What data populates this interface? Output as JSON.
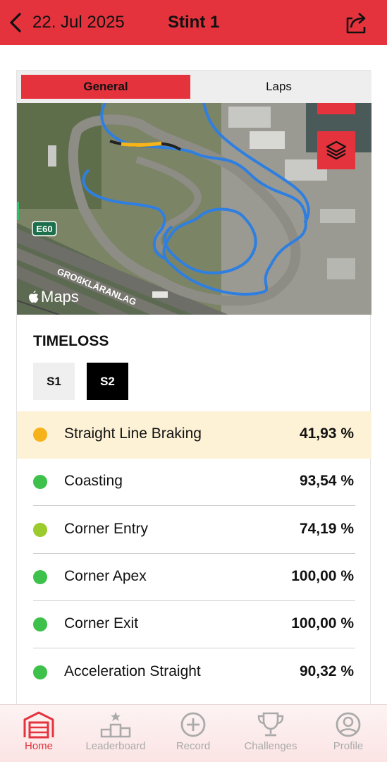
{
  "header": {
    "date": "22. Jul 2025",
    "title": "Stint 1"
  },
  "tabs": [
    {
      "label": "General",
      "active": true
    },
    {
      "label": "Laps",
      "active": false
    }
  ],
  "map": {
    "attribution": "Maps",
    "road_label": "E60",
    "street_label": "GROßKLÄRANLAG"
  },
  "timeloss": {
    "title": "TIMELOSS",
    "sectors": [
      {
        "label": "S1",
        "selected": false
      },
      {
        "label": "S2",
        "selected": true
      }
    ],
    "items": [
      {
        "label": "Straight Line Braking",
        "value": "41,93 %",
        "status_color": "#f5b21b",
        "highlighted": true
      },
      {
        "label": "Coasting",
        "value": "93,54 %",
        "status_color": "#3ec14a",
        "highlighted": false
      },
      {
        "label": "Corner Entry",
        "value": "74,19 %",
        "status_color": "#9ccb2e",
        "highlighted": false
      },
      {
        "label": "Corner Apex",
        "value": "100,00 %",
        "status_color": "#3ec14a",
        "highlighted": false
      },
      {
        "label": "Corner Exit",
        "value": "100,00 %",
        "status_color": "#3ec14a",
        "highlighted": false
      },
      {
        "label": "Acceleration Straight",
        "value": "90,32 %",
        "status_color": "#3ec14a",
        "highlighted": false
      }
    ]
  },
  "nav": [
    {
      "label": "Home",
      "icon": "garage-icon",
      "active": true
    },
    {
      "label": "Leaderboard",
      "icon": "podium-icon",
      "active": false
    },
    {
      "label": "Record",
      "icon": "plus-circle-icon",
      "active": false
    },
    {
      "label": "Challenges",
      "icon": "trophy-icon",
      "active": false
    },
    {
      "label": "Profile",
      "icon": "person-icon",
      "active": false
    }
  ],
  "colors": {
    "accent": "#e5333e",
    "track_line": "#2f7fe0",
    "track_highlight": "#f7b519"
  }
}
